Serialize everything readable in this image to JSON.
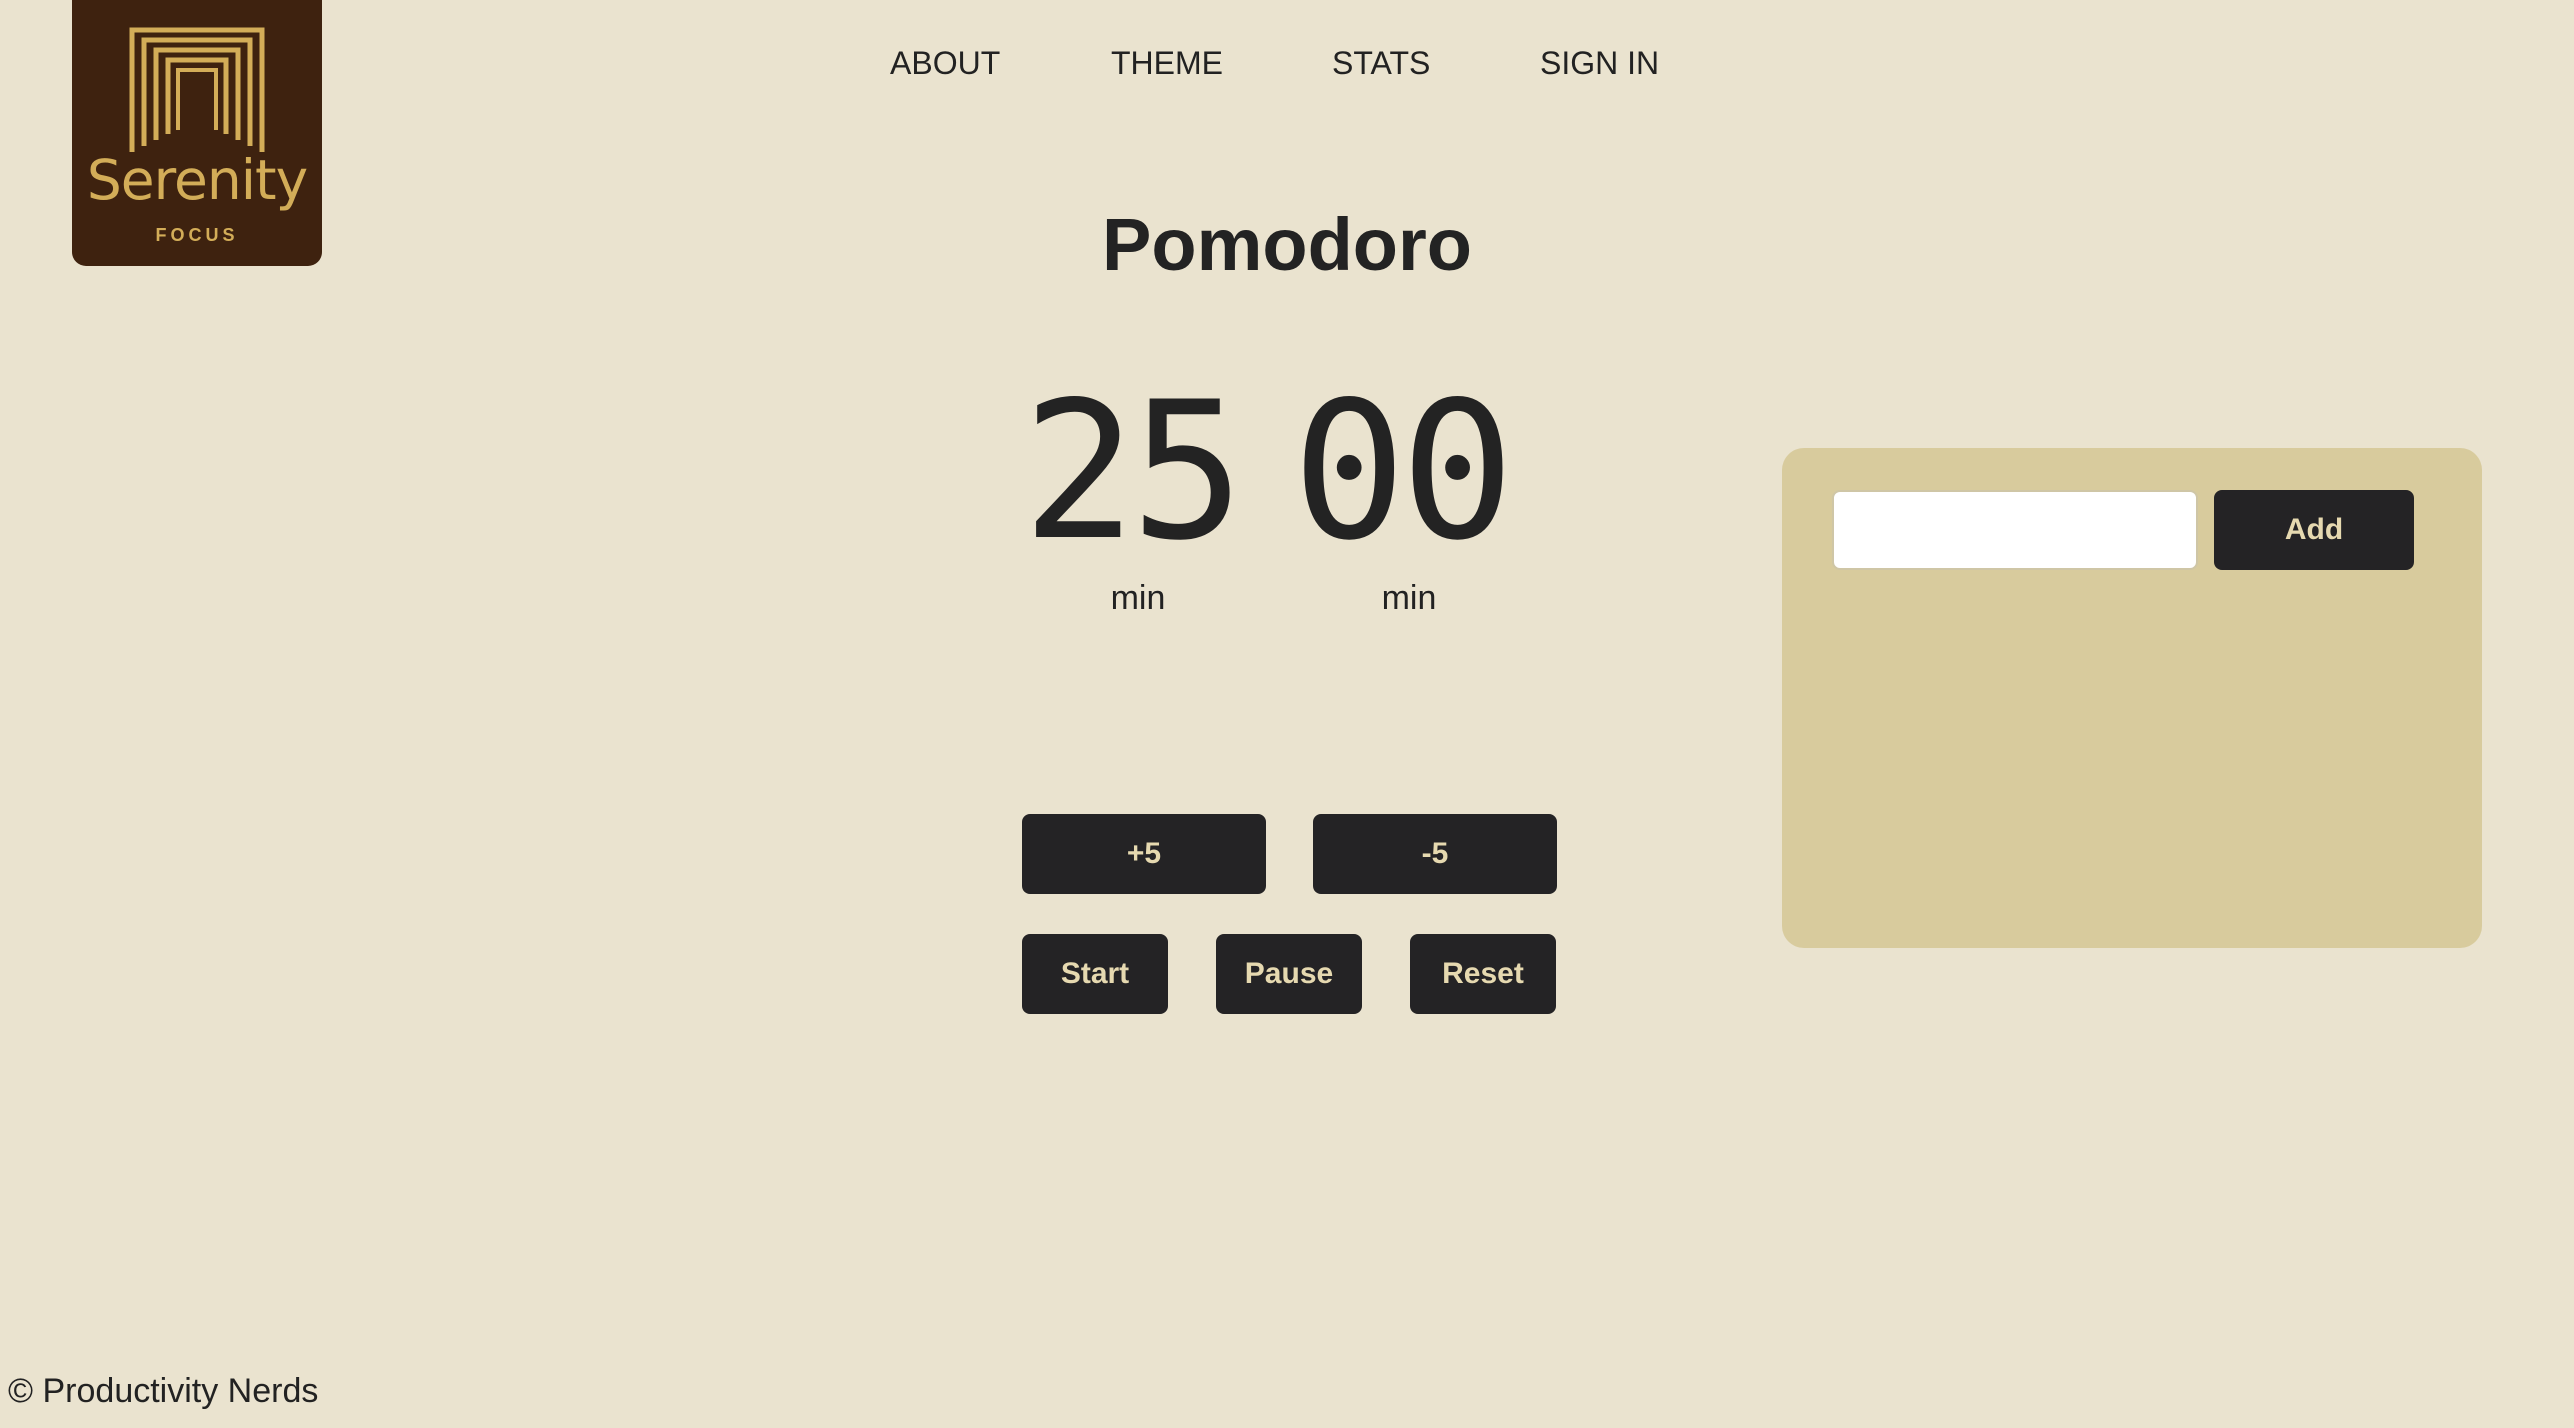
{
  "brand": {
    "name": "Serenity",
    "tagline": "FOCUS",
    "colors": {
      "background": "#3e220f",
      "foreground": "#d3ad58"
    }
  },
  "nav": {
    "items": [
      {
        "label": "ABOUT"
      },
      {
        "label": "THEME"
      },
      {
        "label": "STATS"
      },
      {
        "label": "SIGN IN"
      }
    ]
  },
  "main": {
    "title": "Pomodoro",
    "timer": {
      "minutes": "25",
      "seconds": "00",
      "minutes_unit": "min",
      "seconds_unit": "min"
    },
    "adjust": {
      "plus_label": "+5",
      "minus_label": "-5"
    },
    "controls": {
      "start_label": "Start",
      "pause_label": "Pause",
      "reset_label": "Reset"
    }
  },
  "tasks": {
    "input_value": "",
    "input_placeholder": "",
    "add_label": "Add",
    "items": []
  },
  "footer": {
    "text": "© Productivity Nerds"
  },
  "theme": {
    "page_background": "#eae3cf",
    "panel_background": "#d8cb9d",
    "button_background": "#242325",
    "button_text": "#e6d9b0"
  }
}
